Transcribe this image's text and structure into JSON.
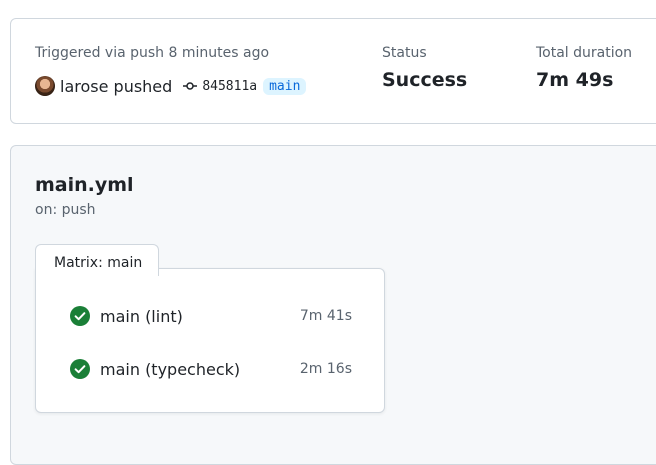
{
  "summary": {
    "trigger": "Triggered via push 8 minutes ago",
    "actor": "larose pushed",
    "commit_sha": "845811a",
    "branch": "main",
    "status_label": "Status",
    "status_value": "Success",
    "duration_label": "Total duration",
    "duration_value": "7m 49s"
  },
  "workflow": {
    "file": "main.yml",
    "trigger": "on: push",
    "matrix_label": "Matrix: main",
    "jobs": [
      {
        "name": "main (lint)",
        "duration": "7m 41s",
        "status": "success"
      },
      {
        "name": "main (typecheck)",
        "duration": "2m 16s",
        "status": "success"
      }
    ]
  },
  "colors": {
    "success": "#1a7f37",
    "branch_text": "#0969da",
    "branch_bg": "#ddf4ff",
    "muted": "#59636e",
    "border": "#d0d7de"
  },
  "icons": {
    "commit": "git-commit-icon",
    "check": "check-circle-fill-icon"
  }
}
